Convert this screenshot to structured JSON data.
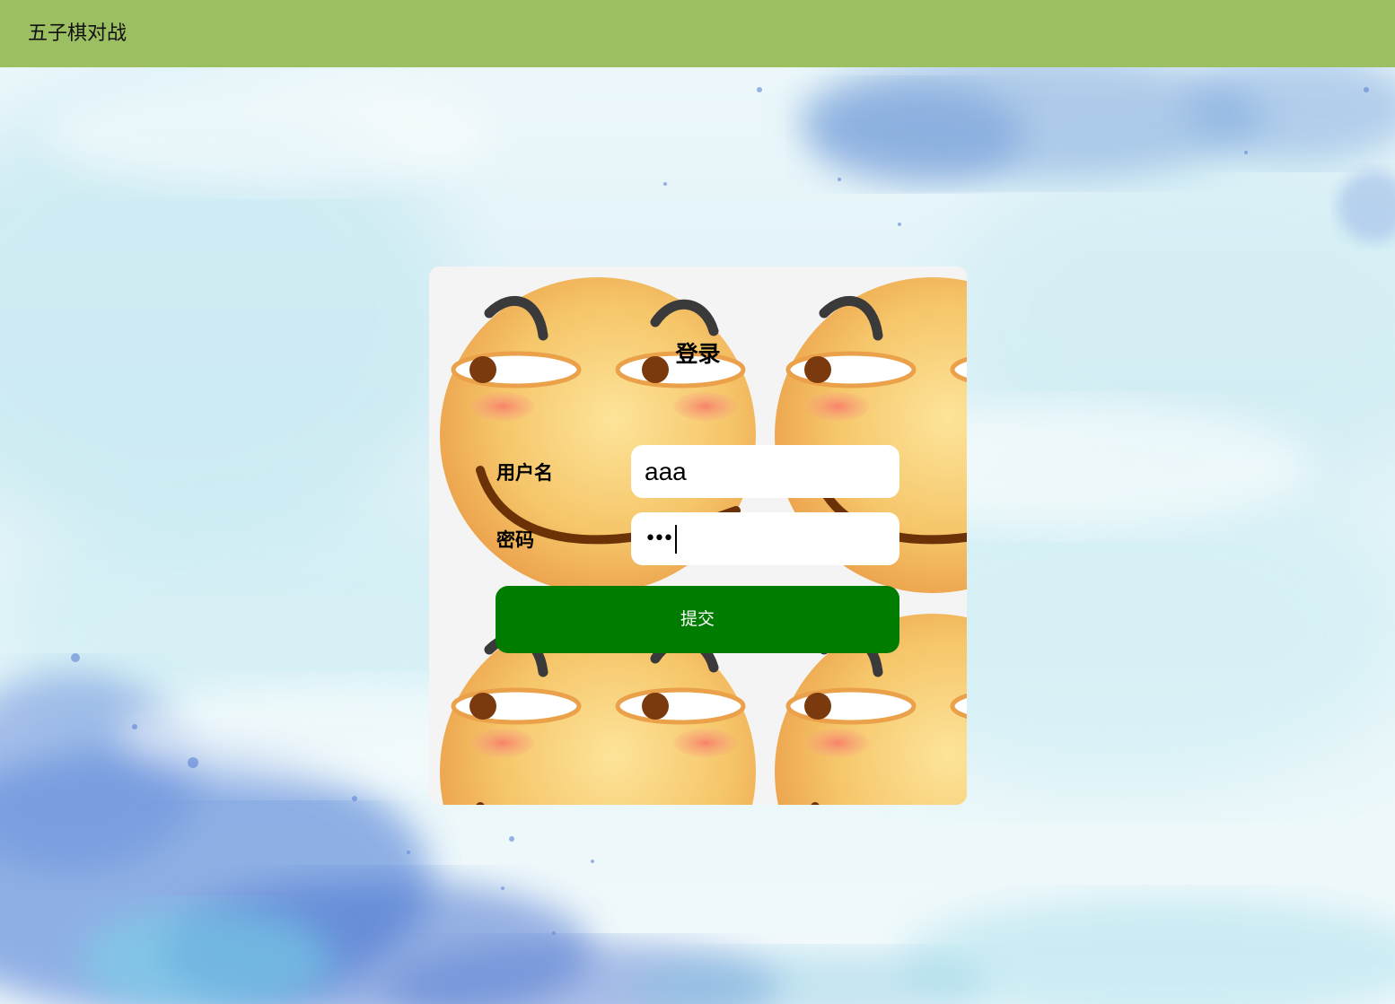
{
  "navbar": {
    "title": "五子棋对战"
  },
  "login": {
    "title": "登录",
    "username_label": "用户名",
    "username_value": "aaa",
    "password_label": "密码",
    "password_masked": "•••",
    "submit_label": "提交"
  },
  "colors": {
    "navbar": "#9cbf61",
    "submit": "#007c00",
    "card": "#f4f4f4"
  },
  "icons": [
    "smirking-emoji-face"
  ]
}
